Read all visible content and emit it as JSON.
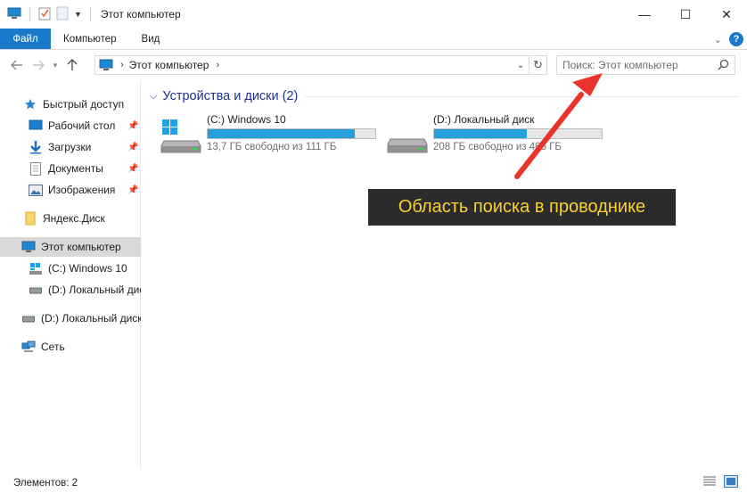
{
  "window": {
    "title": "Этот компьютер",
    "controls": {
      "minimize": "—",
      "maximize": "☐",
      "close": "✕"
    }
  },
  "ribbon": {
    "tabs": [
      "Файл",
      "Компьютер",
      "Вид"
    ]
  },
  "address": {
    "path": "Этот компьютер",
    "search_placeholder": "Поиск: Этот компьютер"
  },
  "sidebar": {
    "items": [
      {
        "label": "Быстрый доступ",
        "icon": "star-icon",
        "pinned": false
      },
      {
        "label": "Рабочий стол",
        "icon": "desktop-icon",
        "pinned": true
      },
      {
        "label": "Загрузки",
        "icon": "download-icon",
        "pinned": true
      },
      {
        "label": "Документы",
        "icon": "document-icon",
        "pinned": true
      },
      {
        "label": "Изображения",
        "icon": "pictures-icon",
        "pinned": true
      },
      {
        "label": "Яндекс.Диск",
        "icon": "folder-icon",
        "pinned": false
      },
      {
        "label": "Этот компьютер",
        "icon": "computer-icon",
        "pinned": false
      },
      {
        "label": "(C:) Windows 10",
        "icon": "windows-drive-icon",
        "pinned": false
      },
      {
        "label": "(D:) Локальный диск",
        "icon": "drive-icon",
        "pinned": false
      },
      {
        "label": "(D:) Локальный диск",
        "icon": "drive-icon",
        "pinned": false
      },
      {
        "label": "Сеть",
        "icon": "network-icon",
        "pinned": false
      }
    ]
  },
  "content": {
    "group_title": "Устройства и диски (2)",
    "drives": [
      {
        "name": "(C:) Windows 10",
        "free_text": "13,7 ГБ свободно из 111 ГБ",
        "used_fraction": 0.877,
        "icon": "windows-drive-icon"
      },
      {
        "name": "(D:) Локальный диск",
        "free_text": "208 ГБ свободно из 465 ГБ",
        "used_fraction": 0.553,
        "icon": "drive-icon"
      }
    ]
  },
  "callout": {
    "text": "Область поиска в проводнике"
  },
  "status": {
    "text": "Элементов: 2"
  },
  "colors": {
    "accent": "#1979ca",
    "progress": "#26a0da",
    "callout_bg": "#2b2b2b",
    "callout_text": "#f6d233",
    "arrow": "#e8342a",
    "group_header": "#1e3287"
  }
}
